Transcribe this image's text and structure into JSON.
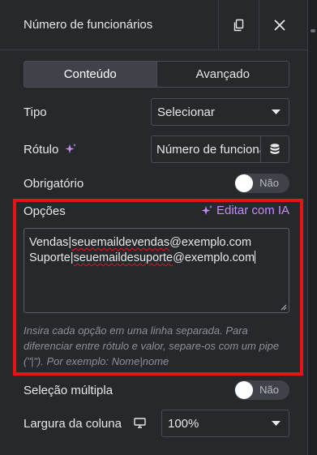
{
  "header": {
    "title": "Número de funcionários",
    "copy_icon": "copy-icon",
    "close_icon": "close-icon"
  },
  "tabs": [
    {
      "label": "Conteúdo",
      "active": true
    },
    {
      "label": "Avançado",
      "active": false
    }
  ],
  "fields": {
    "tipo": {
      "label": "Tipo",
      "value": "Selecionar"
    },
    "rotulo": {
      "label": "Rótulo",
      "value": "Número de funcionários",
      "db_icon": "database-icon"
    },
    "obrigatorio": {
      "label": "Obrigatório",
      "toggle_text": "Não"
    },
    "opcoes": {
      "label": "Opções",
      "ai_link": "Editar com IA",
      "lines": [
        {
          "a": "Vendas",
          "b": "|",
          "c": "seuemaildevendas",
          "d": "@exemplo.com"
        },
        {
          "a": "Suporte",
          "b": "|",
          "c": "seuemaildesuporte",
          "d": "@exemplo.com"
        }
      ],
      "help": "Insira cada opção em uma linha separada. Para diferenciar entre rótulo e valor, separe-os com um pipe (\"|\"). Por exemplo: Nome|nome"
    },
    "selecao_multipla": {
      "label": "Seleção múltipla",
      "toggle_text": "Não"
    },
    "largura": {
      "label": "Largura da coluna",
      "value": "100%",
      "device_icon": "desktop-icon"
    }
  },
  "colors": {
    "background": "#26292c",
    "accent_ai": "#c78cf2",
    "highlight": "#e5141b"
  }
}
